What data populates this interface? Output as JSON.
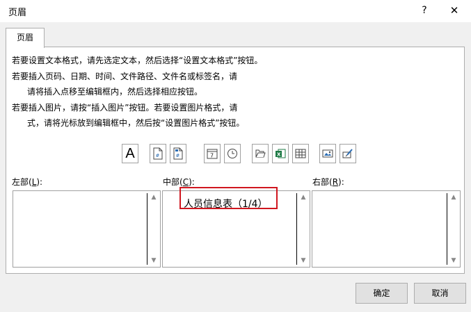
{
  "dialog": {
    "title": "页眉",
    "help": "?",
    "close": "✕"
  },
  "tabs": [
    {
      "label": "页眉"
    }
  ],
  "instructions": [
    "若要设置文本格式，请先选定文本，然后选择“设置文本格式”按钮。",
    "若要插入页码、日期、时间、文件路径、文件名或标签名，请",
    "请将插入点移至编辑框内，然后选择相应按钮。",
    "若要插入图片，请按“插入图片”按钮。若要设置图片格式，请",
    "式，请将光标放到编辑框中，然后按“设置图片格式”按钮。"
  ],
  "toolbar": {
    "buttons": [
      {
        "name": "format-text",
        "glyph": "A"
      },
      {
        "name": "insert-page-number",
        "glyph": "#"
      },
      {
        "name": "insert-page-count",
        "glyph": "+"
      },
      {
        "name": "insert-date",
        "glyph": "7"
      },
      {
        "name": "insert-time",
        "glyph": "clock"
      },
      {
        "name": "insert-file-path",
        "glyph": "folder"
      },
      {
        "name": "insert-file-name",
        "glyph": "excel"
      },
      {
        "name": "insert-sheet-name",
        "glyph": "sheet"
      },
      {
        "name": "insert-picture",
        "glyph": "picture"
      },
      {
        "name": "format-picture",
        "glyph": "format"
      }
    ]
  },
  "sections": {
    "left": {
      "label_prefix": "左部(",
      "hotkey": "L",
      "label_suffix": "):",
      "content": ""
    },
    "center": {
      "label_prefix": "中部(",
      "hotkey": "C",
      "label_suffix": "):",
      "content": "人员信息表（1/4）"
    },
    "right": {
      "label_prefix": "右部(",
      "hotkey": "R",
      "label_suffix": "):",
      "content": ""
    }
  },
  "scroll": {
    "up": "▲",
    "down": "▼"
  },
  "footer": {
    "ok": "确定",
    "cancel": "取消"
  },
  "colors": {
    "highlight": "#d0161f",
    "excel_green": "#1d7a45"
  }
}
